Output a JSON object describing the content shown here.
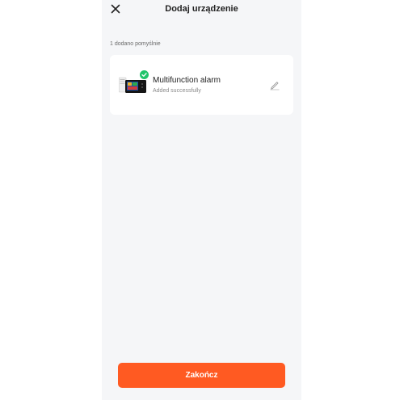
{
  "header": {
    "title": "Dodaj urządzenie",
    "close_icon": "close-icon"
  },
  "summary": {
    "added_count_text": "1 dodano pomyślnie"
  },
  "device": {
    "name": "Multifunction alarm",
    "status": "Added successfully",
    "status_icon": "check-circle-icon",
    "edit_icon": "pencil-icon"
  },
  "footer": {
    "finish_label": "Zakończ"
  },
  "colors": {
    "accent": "#ff5a22",
    "success": "#21c46b",
    "background": "#f5f6f8",
    "card": "#ffffff"
  }
}
